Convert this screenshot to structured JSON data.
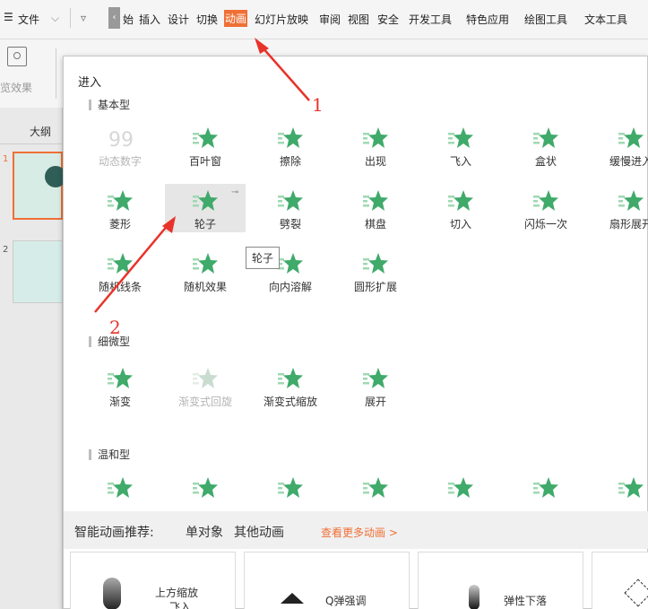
{
  "menubar": {
    "items": [
      "文件",
      "始",
      "插入",
      "设计",
      "切换",
      "动画",
      "幻灯片放映",
      "审阅",
      "视图",
      "安全",
      "开发工具",
      "特色应用",
      "绘图工具",
      "文本工具"
    ],
    "active_item": "动画"
  },
  "toolbar": {
    "preview_label": "览效果"
  },
  "sidepane": {
    "outline_label": "大纲",
    "slide_numbers": [
      "1",
      "2"
    ]
  },
  "panel": {
    "title": "进入",
    "sections": {
      "basic": "基本型",
      "subtle": "细微型",
      "moderate": "温和型"
    },
    "basic_effects": [
      {
        "label": "动态数字",
        "disabled": true
      },
      {
        "label": "百叶窗"
      },
      {
        "label": "擦除"
      },
      {
        "label": "出现"
      },
      {
        "label": "飞入"
      },
      {
        "label": "盒状"
      },
      {
        "label": "缓慢进入"
      },
      {
        "label": "菱形"
      },
      {
        "label": "轮子",
        "selected": true
      },
      {
        "label": "劈裂"
      },
      {
        "label": "棋盘"
      },
      {
        "label": "切入"
      },
      {
        "label": "闪烁一次"
      },
      {
        "label": "扇形展开"
      },
      {
        "label": "随机线条"
      },
      {
        "label": "随机效果"
      },
      {
        "label": "向内溶解"
      },
      {
        "label": "圆形扩展"
      }
    ],
    "subtle_effects": [
      {
        "label": "渐变"
      },
      {
        "label": "渐变式回旋",
        "disabled": true
      },
      {
        "label": "渐变式缩放"
      },
      {
        "label": "展开"
      }
    ],
    "tooltip": "轮子",
    "recommend": {
      "title": "智能动画推荐:",
      "single": "单对象",
      "other": "其他动画",
      "more": "查看更多动画 >"
    },
    "cards": [
      "上方缩放",
      "飞入",
      "Q弹强调",
      "弹性下落"
    ]
  },
  "annotations": {
    "num1": "1",
    "num2": "2"
  },
  "colors": {
    "accent": "#ef6f35",
    "star": "#3faa6a",
    "arrow": "#e8332a"
  }
}
